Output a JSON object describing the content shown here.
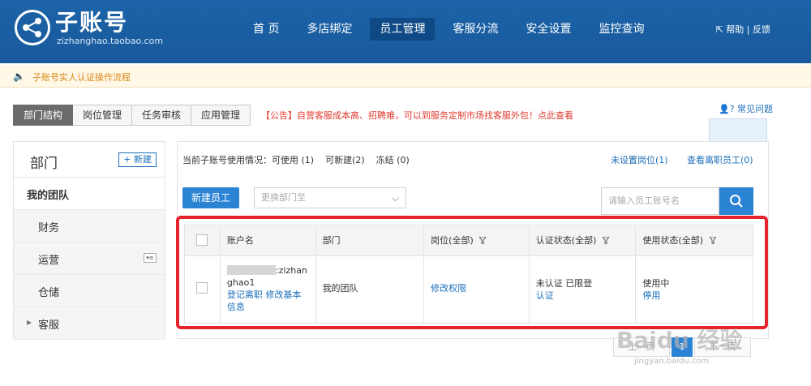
{
  "header": {
    "logo_title": "子账号",
    "logo_sub": "zizhanghao.taobao.com",
    "nav": [
      {
        "label": "首 页",
        "active": false
      },
      {
        "label": "多店绑定",
        "active": false
      },
      {
        "label": "员工管理",
        "active": true
      },
      {
        "label": "客服分流",
        "active": false
      },
      {
        "label": "安全设置",
        "active": false
      },
      {
        "label": "监控查询",
        "active": false
      }
    ],
    "help": "帮助 | 反馈"
  },
  "notice": {
    "text": "子账号实人认证操作流程"
  },
  "tabs": [
    {
      "label": "部门结构",
      "active": true
    },
    {
      "label": "岗位管理",
      "active": false
    },
    {
      "label": "任务审核",
      "active": false
    },
    {
      "label": "应用管理",
      "active": false
    }
  ],
  "announcement": "【公告】自营客服成本高、招聘难，可以到服务定制市场找客服外包！点此查看",
  "faq": {
    "label": "常见问题"
  },
  "left_panel": {
    "title": "部门",
    "new_button": "+ 新建",
    "items": [
      {
        "label": "我的团队"
      },
      {
        "label": "财务"
      },
      {
        "label": "运营"
      },
      {
        "label": "仓储"
      },
      {
        "label": "客服"
      }
    ]
  },
  "right_panel": {
    "usage_prefix": "当前子账号使用情况：",
    "available": "可使用 (1)",
    "creatable": "可新建(2)",
    "frozen": "冻结 (0)",
    "unset_post": "未设置岗位(1)",
    "view_resigned": "查看离职员工(0)",
    "new_employee": "新建员工",
    "select_placeholder": "更换部门至",
    "search_placeholder": "请输入员工账号名",
    "table": {
      "headers": [
        "账户名",
        "部门",
        "岗位(全部)",
        "认证状态(全部)",
        "使用状态(全部)"
      ],
      "row": {
        "account_suffix": ":zizhan",
        "account_line2": "ghao1",
        "link_resign": "登记离职",
        "link_edit": "修改基本",
        "link_edit2": "信息",
        "department": "我的团队",
        "post_link": "修改权限",
        "cert_status": "未认证 已限登",
        "cert_link": "认证",
        "use_status": "使用中",
        "use_link": "停用"
      }
    }
  },
  "pager": {
    "prev": "上一页",
    "current": "1",
    "next": "下一页"
  },
  "watermark": {
    "main": "Baidu 经验",
    "sub": "jingyan.baidu.com"
  },
  "colors": {
    "header_bg": "#1b63a8",
    "accent": "#2b83d4",
    "highlight": "#e5232a",
    "notice": "#d8881a"
  }
}
